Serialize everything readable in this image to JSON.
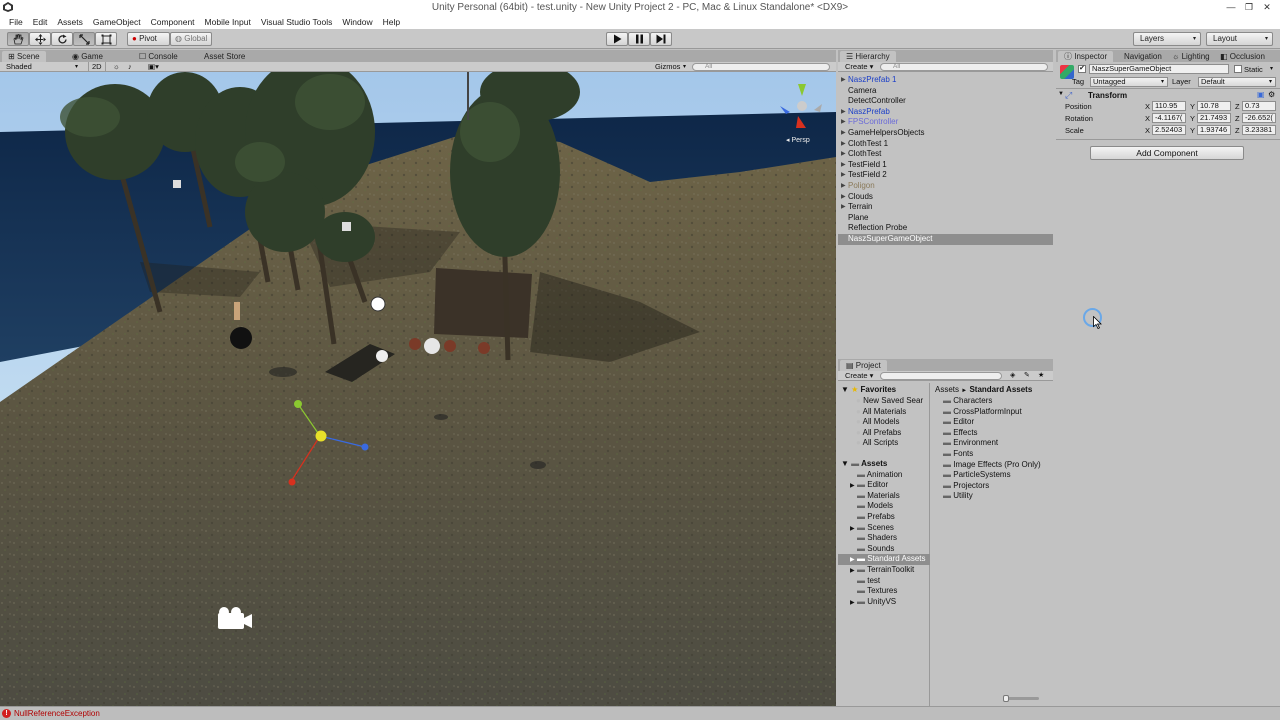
{
  "window": {
    "title": "Unity Personal (64bit) - test.unity - New Unity Project 2 - PC, Mac & Linux Standalone* <DX9>"
  },
  "menu": [
    "File",
    "Edit",
    "Assets",
    "GameObject",
    "Component",
    "Mobile Input",
    "Visual Studio Tools",
    "Window",
    "Help"
  ],
  "toolbar": {
    "pivot": "Pivot",
    "global": "Global",
    "layers": "Layers",
    "layout": "Layout"
  },
  "scene_panel": {
    "tabs": [
      "Scene",
      "Game",
      "Console",
      "Asset Store"
    ],
    "shading": "Shaded",
    "mode_2d": "2D",
    "gizmos": "Gizmos",
    "search_placeholder": "All",
    "persp_label": "Persp"
  },
  "hierarchy": {
    "tab": "Hierarchy",
    "create": "Create",
    "search_placeholder": "All",
    "items": [
      {
        "label": "NaszPrefab 1",
        "expandable": true,
        "type": "prefab"
      },
      {
        "label": "Camera",
        "expandable": false,
        "type": "normal"
      },
      {
        "label": "DetectController",
        "expandable": false,
        "type": "normal"
      },
      {
        "label": "NaszPrefab",
        "expandable": true,
        "type": "prefab"
      },
      {
        "label": "FPSController",
        "expandable": true,
        "type": "missing"
      },
      {
        "label": "GameHelpersObjects",
        "expandable": true,
        "type": "normal"
      },
      {
        "label": "ClothTest 1",
        "expandable": true,
        "type": "normal"
      },
      {
        "label": "ClothTest",
        "expandable": true,
        "type": "normal"
      },
      {
        "label": "TestField 1",
        "expandable": true,
        "type": "normal"
      },
      {
        "label": "TestField 2",
        "expandable": true,
        "type": "normal"
      },
      {
        "label": "Poligon",
        "expandable": true,
        "type": "missing"
      },
      {
        "label": "Clouds",
        "expandable": true,
        "type": "normal"
      },
      {
        "label": "Terrain",
        "expandable": true,
        "type": "normal"
      },
      {
        "label": "Plane",
        "expandable": false,
        "type": "normal"
      },
      {
        "label": "Reflection Probe",
        "expandable": false,
        "type": "normal"
      },
      {
        "label": "NaszSuperGameObject",
        "expandable": false,
        "type": "selected"
      }
    ]
  },
  "project": {
    "tab": "Project",
    "create": "Create",
    "favorites_label": "Favorites",
    "favorites": [
      "New Saved Sear",
      "All Materials",
      "All Models",
      "All Prefabs",
      "All Scripts"
    ],
    "assets_label": "Assets",
    "assets": [
      {
        "label": "Animation",
        "expandable": false
      },
      {
        "label": "Editor",
        "expandable": true
      },
      {
        "label": "Materials",
        "expandable": false
      },
      {
        "label": "Models",
        "expandable": false
      },
      {
        "label": "Prefabs",
        "expandable": false
      },
      {
        "label": "Scenes",
        "expandable": true
      },
      {
        "label": "Shaders",
        "expandable": false
      },
      {
        "label": "Sounds",
        "expandable": false
      },
      {
        "label": "Standard Assets",
        "expandable": true,
        "selected": true
      },
      {
        "label": "TerrainToolkit",
        "expandable": true
      },
      {
        "label": "test",
        "expandable": false
      },
      {
        "label": "Textures",
        "expandable": false
      },
      {
        "label": "UnityVS",
        "expandable": true
      }
    ],
    "breadcrumb_root": "Assets",
    "breadcrumb_sep": "►",
    "breadcrumb_current": "Standard Assets",
    "folders": [
      "Characters",
      "CrossPlatformInput",
      "Editor",
      "Effects",
      "Environment",
      "Fonts",
      "Image Effects (Pro Only)",
      "ParticleSystems",
      "Projectors",
      "Utility"
    ]
  },
  "inspector": {
    "tabs": [
      "Inspector",
      "Navigation",
      "Lighting",
      "Occlusion"
    ],
    "object_name": "NaszSuperGameObject",
    "static_label": "Static",
    "tag_label": "Tag",
    "tag_value": "Untagged",
    "layer_label": "Layer",
    "layer_value": "Default",
    "transform_label": "Transform",
    "position_label": "Position",
    "rotation_label": "Rotation",
    "scale_label": "Scale",
    "position": {
      "x": "110.95",
      "y": "10.78",
      "z": "0.73"
    },
    "rotation": {
      "x": "-4.1167(",
      "y": "21.7493",
      "z": "-26.652("
    },
    "scale": {
      "x": "2.52403",
      "y": "1.93746",
      "z": "3.23381"
    },
    "add_component": "Add Component"
  },
  "statusbar": {
    "message": "NullReferenceException"
  },
  "colors": {
    "panel_bg": "#c2c2c2",
    "selection": "#8e8e8e",
    "prefab_text": "#1a3ec8",
    "error_red": "#d21f1f"
  }
}
